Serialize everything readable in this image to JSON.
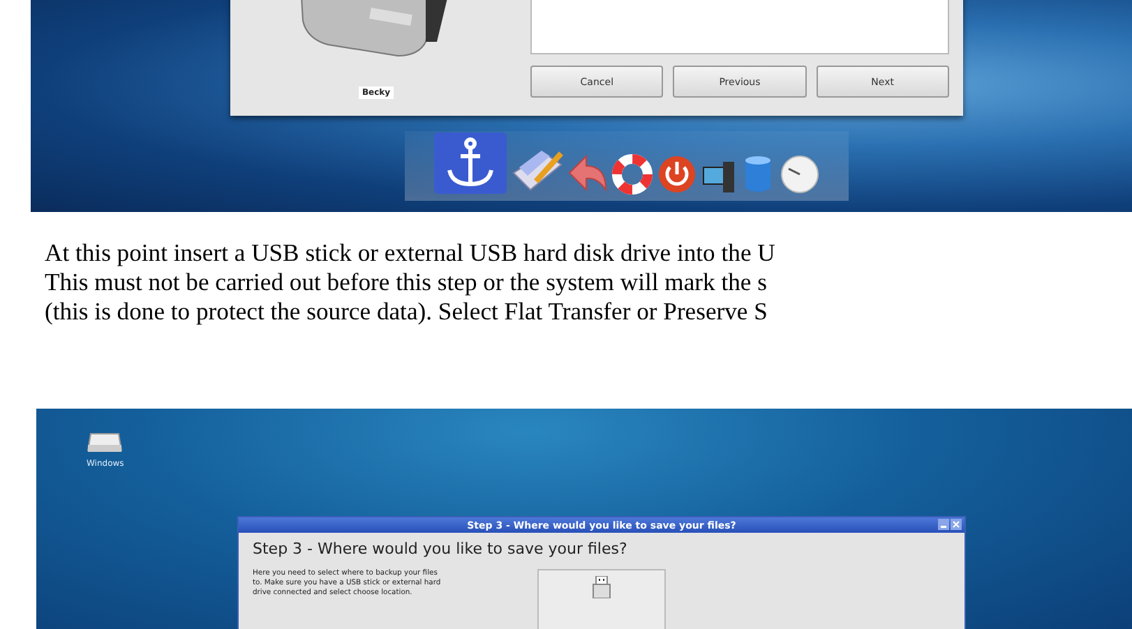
{
  "screenshot_1": {
    "window": {
      "drive_label": "Becky",
      "buttons": [
        "Cancel",
        "Previous",
        "Next"
      ]
    }
  },
  "paragraph": {
    "lines": [
      "At this point insert a USB stick or external USB hard disk drive into the U",
      "This must not be carried out before this step or the system will mark the s",
      "(this is done to protect the source data). Select Flat Transfer or Preserve S"
    ]
  },
  "screenshot_2": {
    "desktop_icon": {
      "label": "Windows"
    },
    "window": {
      "title": "Step 3 - Where would you like to save your files?",
      "heading": "Step 3 - Where would you like to save your files?",
      "description_lines": [
        "Here you need to select where to backup your files",
        "to. Make sure you have a USB stick or external hard",
        "drive connected and select choose location."
      ]
    }
  }
}
